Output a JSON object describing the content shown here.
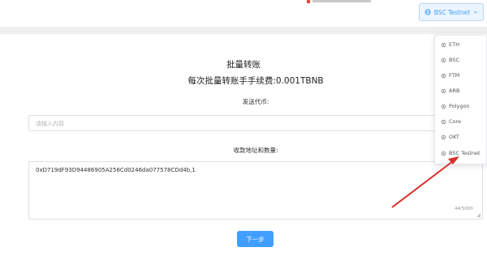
{
  "header": {
    "network_button_label": "BSC Testnet",
    "network_button_icon": "globe-icon",
    "dropdown_caret_icon": "chevron-down-icon"
  },
  "form": {
    "title": "批量转账",
    "fee_text": "每次批量转账手手续费:0.001TBNB",
    "sender_label": "发送代币:",
    "sender_placeholder": "请输入内容",
    "recipients_label": "收款地址和数量:",
    "recipients_value": "0xD719dF93D94486905A256Cd0246da077578CDd4b,1",
    "char_counter": "44/5000",
    "next_button_label": "下一步"
  },
  "network_menu": {
    "items": [
      {
        "label": "ETH",
        "icon": "globe-icon"
      },
      {
        "label": "BSC",
        "icon": "globe-icon"
      },
      {
        "label": "FTM",
        "icon": "globe-icon"
      },
      {
        "label": "ARB",
        "icon": "globe-icon"
      },
      {
        "label": "Polygon",
        "icon": "globe-icon"
      },
      {
        "label": "Core",
        "icon": "globe-icon"
      },
      {
        "label": "OKT",
        "icon": "globe-icon"
      },
      {
        "label": "BSC Testnet",
        "icon": "globe-icon"
      }
    ]
  },
  "colors": {
    "primary": "#409eff",
    "annotation_arrow": "#d9302a",
    "border": "#dcdfe6",
    "band": "#efefef"
  }
}
